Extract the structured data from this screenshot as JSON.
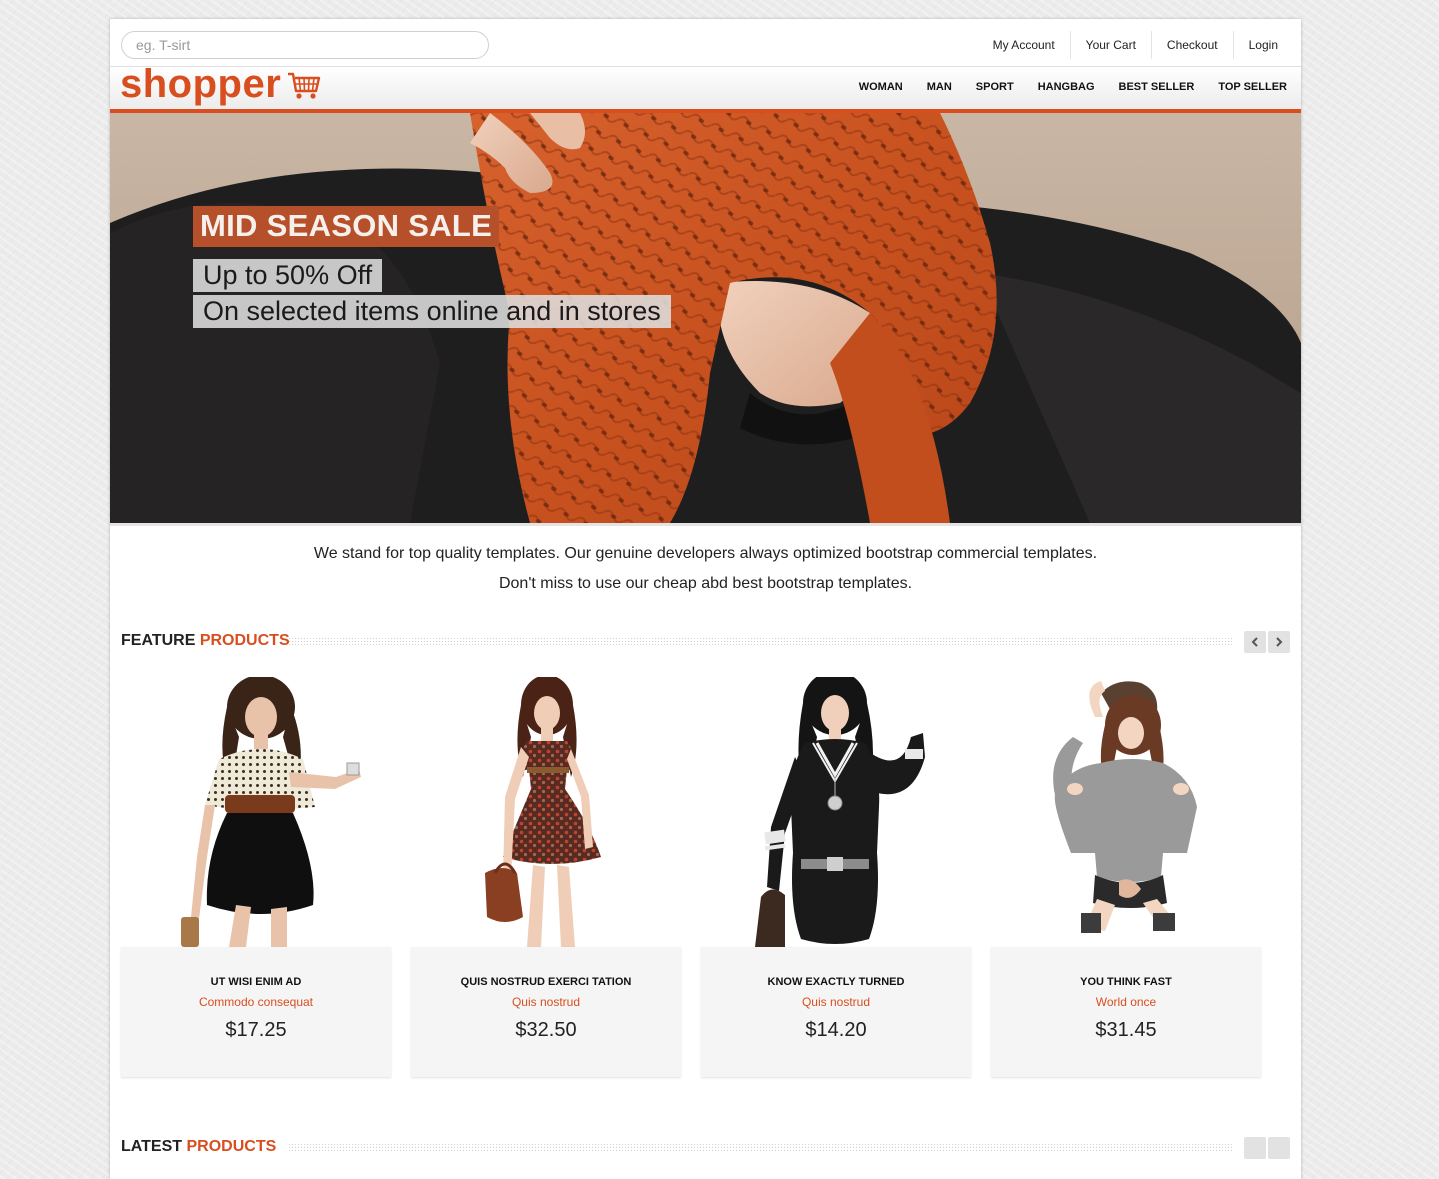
{
  "search": {
    "placeholder": "eg. T-sirt"
  },
  "account_links": [
    "My Account",
    "Your Cart",
    "Checkout",
    "Login"
  ],
  "logo": {
    "text": "shopper",
    "icon": "shopping-cart-icon"
  },
  "nav": [
    "WOMAN",
    "MAN",
    "SPORT",
    "HANGBAG",
    "BEST SELLER",
    "TOP SELLER"
  ],
  "hero": {
    "title": "MID SEASON SALE",
    "line1": "Up to 50% Off",
    "line2": "On selected items online and in stores"
  },
  "intro": {
    "line1": "We stand for top quality templates. Our genuine developers always optimized bootstrap commercial templates.",
    "line2": "Don't miss to use our cheap abd best bootstrap templates."
  },
  "featured": {
    "title_plain": "FEATURE",
    "title_accent": "PRODUCTS",
    "prev_icon": "chevron-left-icon",
    "next_icon": "chevron-right-icon",
    "items": [
      {
        "name": "UT WISI ENIM AD",
        "subtitle": "Commodo consequat",
        "price": "$17.25"
      },
      {
        "name": "QUIS NOSTRUD EXERCI TATION",
        "subtitle": "Quis nostrud",
        "price": "$32.50"
      },
      {
        "name": "KNOW EXACTLY TURNED",
        "subtitle": "Quis nostrud",
        "price": "$14.20"
      },
      {
        "name": "YOU THINK FAST",
        "subtitle": "World once",
        "price": "$31.45"
      }
    ]
  },
  "latest": {
    "title_plain": "LATEST",
    "title_accent": "PRODUCTS"
  },
  "colors": {
    "accent": "#d94e1f",
    "hero_title_bg": "#b6502a"
  }
}
